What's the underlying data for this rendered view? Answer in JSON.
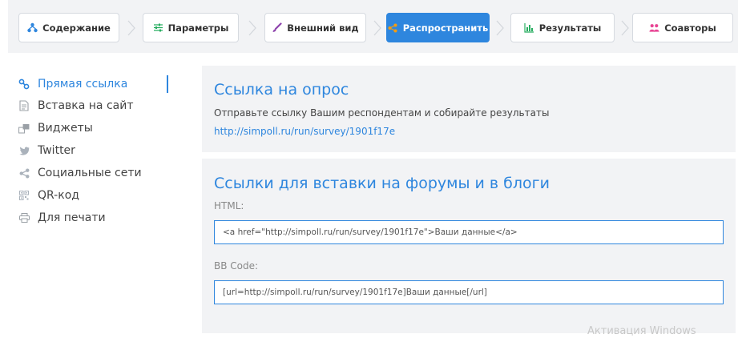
{
  "steps": [
    {
      "label": "Содержание",
      "icon": "sitemap-icon"
    },
    {
      "label": "Параметры",
      "icon": "sliders-icon"
    },
    {
      "label": "Внешний вид",
      "icon": "brush-icon"
    },
    {
      "label": "Распространить",
      "icon": "share-icon",
      "active": true
    },
    {
      "label": "Результаты",
      "icon": "bar-chart-icon"
    },
    {
      "label": "Соавторы",
      "icon": "users-icon"
    }
  ],
  "sidebar": {
    "items": [
      {
        "label": "Прямая ссылка",
        "icon": "link-icon",
        "active": true
      },
      {
        "label": "Вставка на сайт",
        "icon": "document-icon"
      },
      {
        "label": "Виджеты",
        "icon": "widgets-icon"
      },
      {
        "label": "Twitter",
        "icon": "twitter-icon"
      },
      {
        "label": "Социальные сети",
        "icon": "share-icon"
      },
      {
        "label": "QR-код",
        "icon": "qr-code-icon"
      },
      {
        "label": "Для печати",
        "icon": "printer-icon"
      }
    ]
  },
  "direct_link": {
    "title": "Ссылка на опрос",
    "description": "Отправьте ссылку Вашим респондентам и собирайте результаты",
    "url": "http://simpoll.ru/run/survey/1901f17e"
  },
  "embed": {
    "title": "Ссылки для вставки на форумы и в блоги",
    "html_label": "HTML:",
    "html_value": "<a href=\"http://simpoll.ru/run/survey/1901f17e\">Ваши данные</a>",
    "bb_label": "BB Code:",
    "bb_value": "[url=http://simpoll.ru/run/survey/1901f17e]Ваши данные[/url]"
  },
  "watermark": "Активация Windows",
  "colors": {
    "accent": "#2e86de",
    "panel_bg": "#f2f3f5",
    "icon_gray": "#9aa0a6"
  }
}
